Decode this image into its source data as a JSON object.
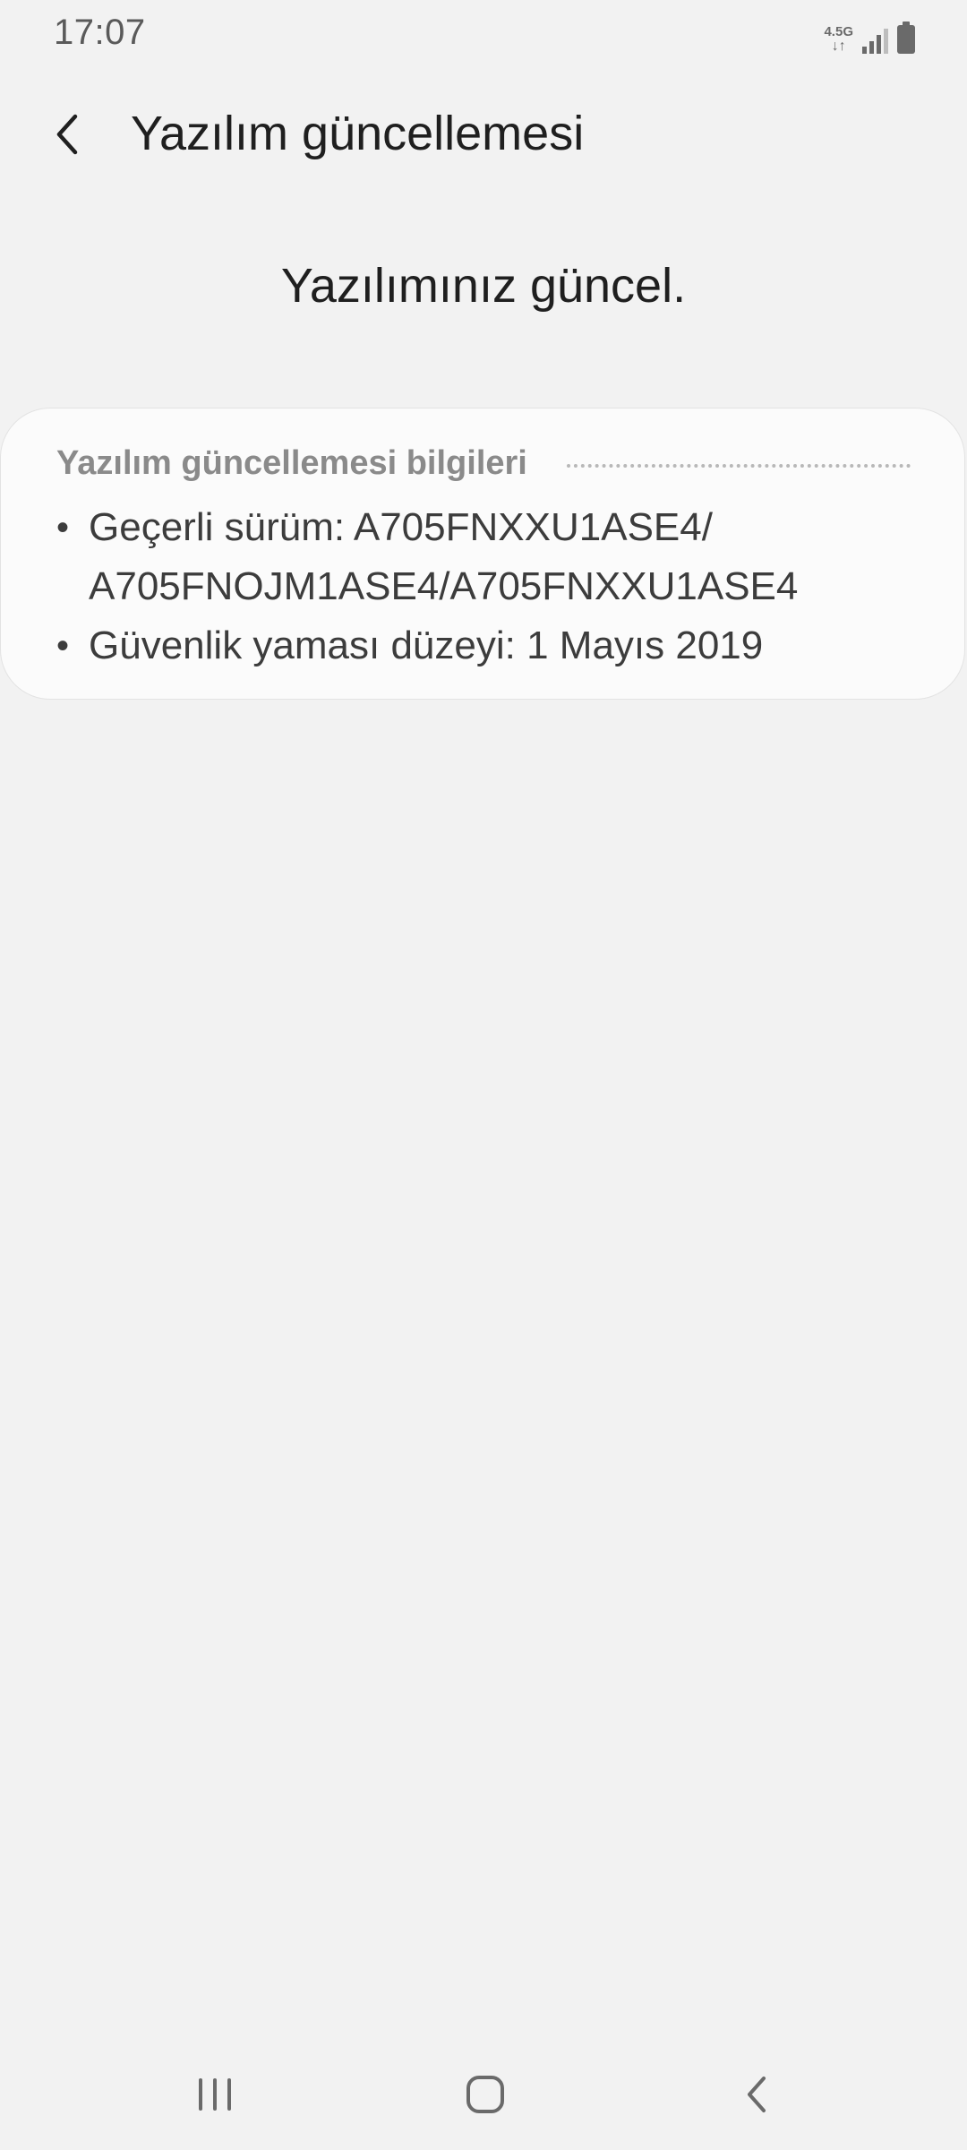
{
  "status_bar": {
    "time": "17:07",
    "network_type": "4.5G",
    "network_arrows": "↓↑",
    "icons": [
      "network-type-icon",
      "signal-icon",
      "battery-icon"
    ]
  },
  "header": {
    "title": "Yazılım güncellemesi",
    "back_icon": "chevron-left-icon"
  },
  "status_message": "Yazılımınız güncel.",
  "info_card": {
    "title": "Yazılım güncellemesi bilgileri",
    "items": [
      {
        "line1": "Geçerli sürüm: A705FNXXU1ASE4/",
        "line2": "A705FNOJM1ASE4/A705FNXXU1ASE4"
      },
      {
        "line1": "Güvenlik yaması düzeyi: 1 Mayıs 2019"
      }
    ],
    "bullet": "•"
  },
  "nav_bar": {
    "buttons": [
      "recent-apps-icon",
      "home-icon",
      "back-icon"
    ]
  },
  "colors": {
    "background": "#f2f2f2",
    "card_background": "#fbfbfb",
    "title_text": "#1f1f1f",
    "secondary_text": "#8a8a8a",
    "icon_gray": "#6a6a6a"
  }
}
